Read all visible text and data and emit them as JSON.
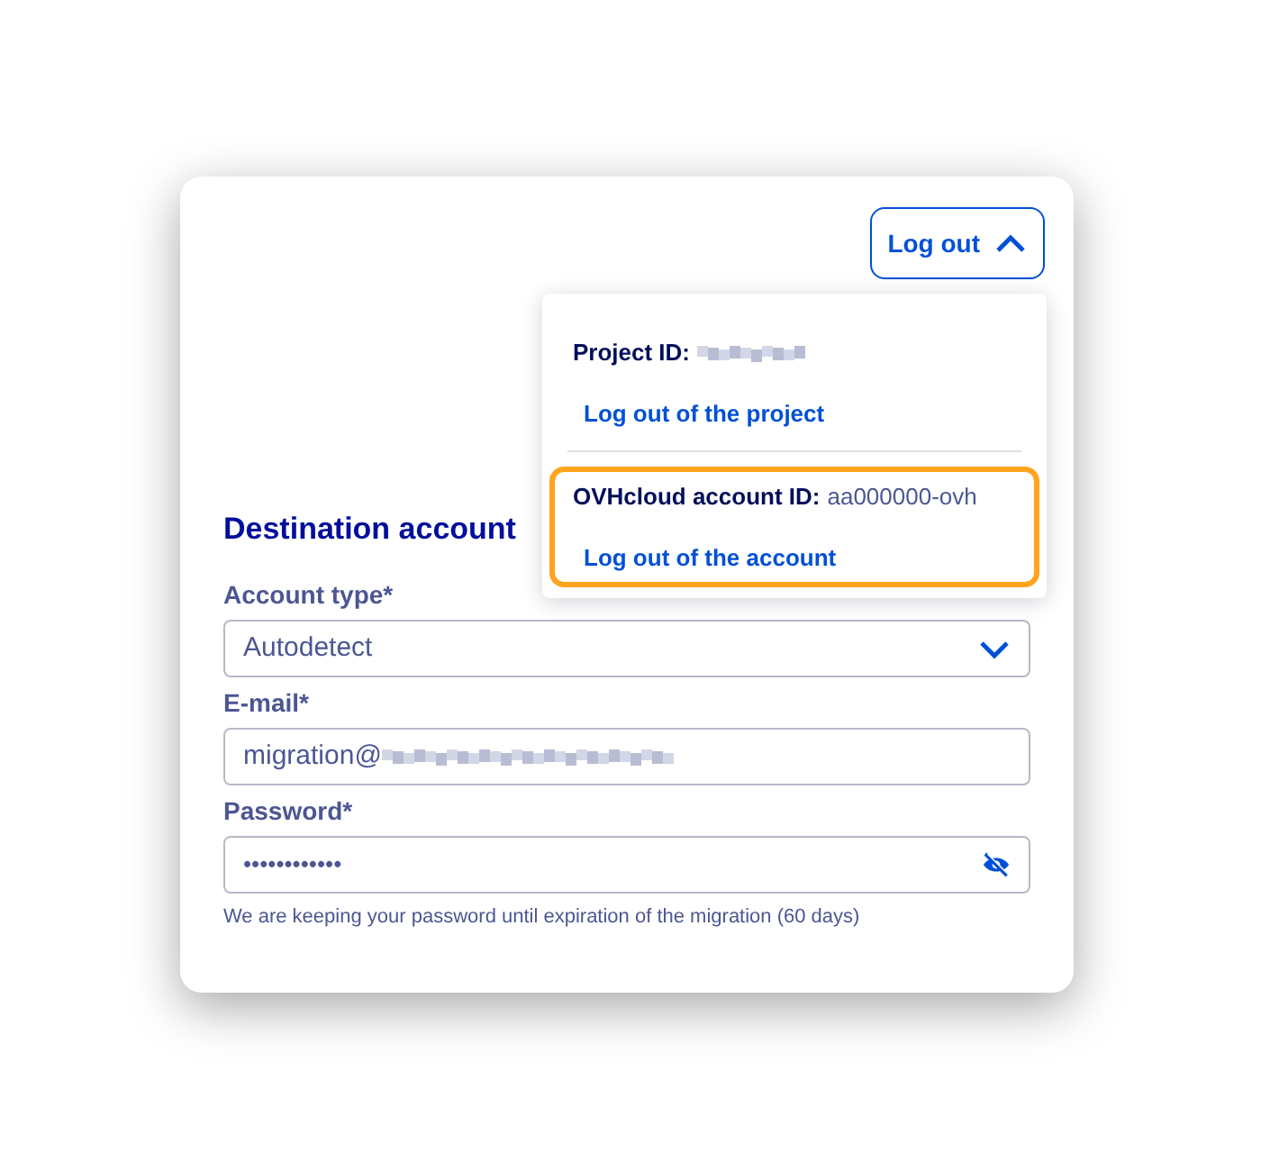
{
  "logout_button": {
    "label": "Log out",
    "expanded": true
  },
  "menu": {
    "sections": [
      {
        "label": "Project ID:",
        "value_redacted": true,
        "action": "Log out of the project",
        "highlighted": false
      },
      {
        "label": "OVHcloud account ID:",
        "value": "aa000000-ovh",
        "action": "Log out of the account",
        "highlighted": true
      }
    ]
  },
  "form": {
    "title": "Destination account",
    "fields": [
      {
        "kind": "select",
        "label": "Account type*",
        "value": "Autodetect"
      },
      {
        "kind": "email",
        "label": "E-mail*",
        "value": "migration@",
        "value_redacted": true
      },
      {
        "kind": "password",
        "label": "Password*",
        "value": "••••••••••••",
        "hint": "We are keeping your password until expiration of the migration (60 days)"
      }
    ]
  }
}
